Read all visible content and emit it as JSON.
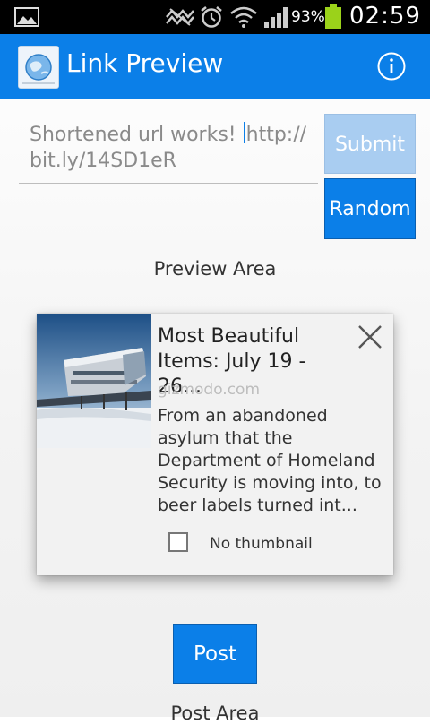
{
  "status_bar": {
    "battery_percent": "93%",
    "time": "02:59",
    "icons": [
      "gallery-icon",
      "mute-icon",
      "alarm-icon",
      "wifi-icon",
      "signal-icon",
      "battery-icon"
    ]
  },
  "action_bar": {
    "title": "Link Preview",
    "color": "#0b7fe8",
    "icons": [
      "app-globe-icon",
      "info-icon"
    ]
  },
  "url_input": {
    "before_caret": "Shortened url works! ",
    "after_caret": "http://bit.ly/14SD1eR"
  },
  "buttons": {
    "submit": "Submit",
    "random": "Random",
    "post": "Post"
  },
  "labels": {
    "preview_area": "Preview Area",
    "post_area": "Post Area"
  },
  "preview_card": {
    "title": "Most Beautiful Items: July 19 - 26...",
    "domain": "gizmodo.com",
    "description": "From an abandoned asylum that the Department of Homeland Security is moving into, to beer labels turned int...",
    "no_thumbnail_label": "No thumbnail",
    "no_thumbnail_checked": false
  }
}
